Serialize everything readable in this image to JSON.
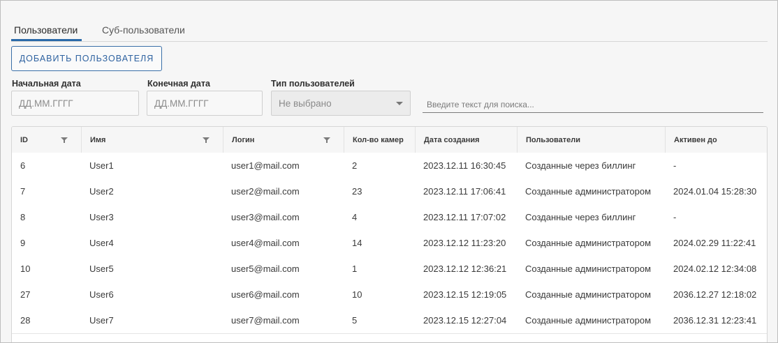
{
  "tabs": [
    {
      "label": "Пользователи",
      "active": true
    },
    {
      "label": "Суб-пользователи",
      "active": false
    }
  ],
  "add_button": {
    "label": "ДОБАВИТЬ ПОЛЬЗОВАТЕЛЯ"
  },
  "filters": {
    "start_date": {
      "label": "Начальная дата",
      "placeholder": "ДД.ММ.ГГГГ"
    },
    "end_date": {
      "label": "Конечная дата",
      "placeholder": "ДД.ММ.ГГГГ"
    },
    "user_type": {
      "label": "Тип пользователей",
      "value": "Не выбрано"
    },
    "search": {
      "placeholder": "Введите текст для поиска..."
    }
  },
  "table": {
    "columns": [
      {
        "label": "ID",
        "filterable": true
      },
      {
        "label": "Имя",
        "filterable": true
      },
      {
        "label": "Логин",
        "filterable": true
      },
      {
        "label": "Кол-во камер",
        "filterable": false
      },
      {
        "label": "Дата создания",
        "filterable": false
      },
      {
        "label": "Пользователи",
        "filterable": false
      },
      {
        "label": "Активен до",
        "filterable": false
      }
    ],
    "rows": [
      [
        "6",
        "User1",
        "user1@mail.com",
        "2",
        "2023.12.11 16:30:45",
        "Созданные через биллинг",
        "-"
      ],
      [
        "7",
        "User2",
        "user2@mail.com",
        "23",
        "2023.12.11 17:06:41",
        "Созданные администратором",
        "2024.01.04 15:28:30"
      ],
      [
        "8",
        "User3",
        "user3@mail.com",
        "4",
        "2023.12.11 17:07:02",
        "Созданные через биллинг",
        "-"
      ],
      [
        "9",
        "User4",
        "user4@mail.com",
        "14",
        "2023.12.12 11:23:20",
        "Созданные администратором",
        "2024.02.29 11:22:41"
      ],
      [
        "10",
        "User5",
        "user5@mail.com",
        "1",
        "2023.12.12 12:36:21",
        "Созданные администратором",
        "2024.02.12 12:34:08"
      ],
      [
        "27",
        "User6",
        "user6@mail.com",
        "10",
        "2023.12.15 12:19:05",
        "Созданные администратором",
        "2036.12.27 12:18:02"
      ],
      [
        "28",
        "User7",
        "user7@mail.com",
        "5",
        "2023.12.15 12:27:04",
        "Созданные администратором",
        "2036.12.31 12:23:41"
      ]
    ]
  }
}
